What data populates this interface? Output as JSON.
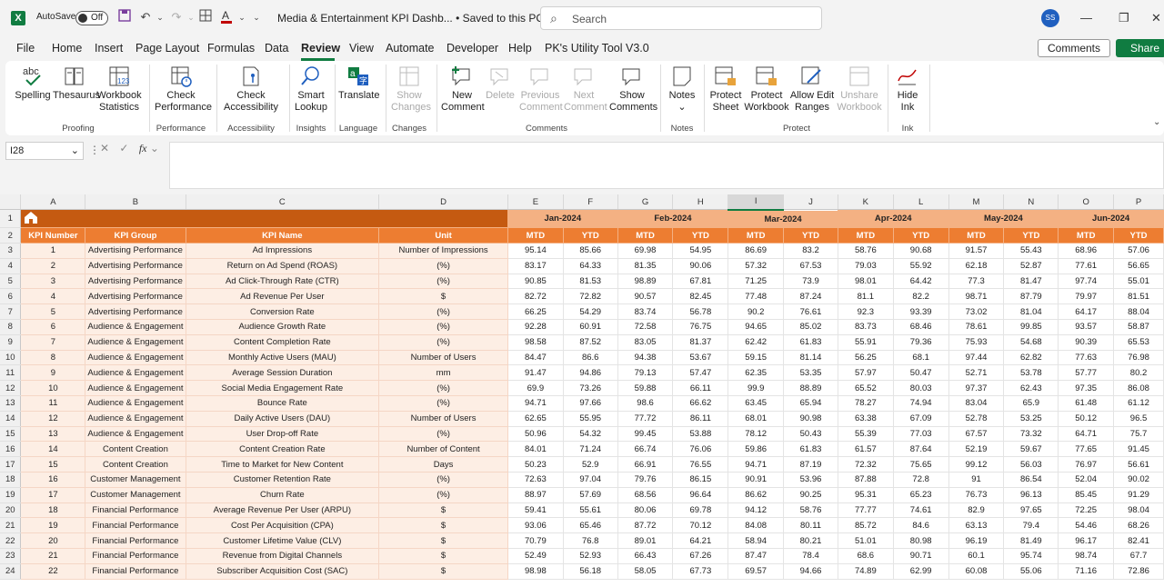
{
  "titlebar": {
    "app_logo": "X",
    "autosave_label": "AutoSave",
    "autosave_state": "Off",
    "doc_title": "Media & Entertainment KPI Dashb...  •  Saved to this PC",
    "search_placeholder": "Search",
    "user_initials": "SS"
  },
  "menu": [
    "File",
    "Home",
    "Insert",
    "Page Layout",
    "Formulas",
    "Data",
    "Review",
    "View",
    "Automate",
    "Developer",
    "Help",
    "PK's Utility Tool V3.0"
  ],
  "menu_active": "Review",
  "comments_button": "Comments",
  "share_button": "Share",
  "ribbon": {
    "spelling": "Spelling",
    "thesaurus": "Thesaurus",
    "workbook_stats": "Workbook Statistics",
    "proofing": "Proofing",
    "check_performance": "Check Performance",
    "performance": "Performance",
    "check_accessibility": "Check Accessibility",
    "accessibility": "Accessibility",
    "smart_lookup": "Smart Lookup",
    "insights": "Insights",
    "translate": "Translate",
    "language": "Language",
    "show_changes": "Show Changes",
    "changes": "Changes",
    "new_comment": "New Comment",
    "delete": "Delete",
    "previous_comment": "Previous Comment",
    "next_comment": "Next Comment",
    "show_comments": "Show Comments",
    "comments": "Comments",
    "notes_btn": "Notes",
    "notes": "Notes",
    "protect_sheet": "Protect Sheet",
    "protect_workbook": "Protect Workbook",
    "allow_edit_ranges": "Allow Edit Ranges",
    "unshare_workbook": "Unshare Workbook",
    "protect": "Protect",
    "hide_ink": "Hide Ink",
    "ink": "Ink"
  },
  "formula_bar": {
    "name_box": "I28",
    "fx": "fx"
  },
  "columns": [
    "A",
    "B",
    "C",
    "D",
    "E",
    "F",
    "G",
    "H",
    "I",
    "J",
    "K",
    "L",
    "M",
    "N",
    "O",
    "P"
  ],
  "months": [
    "Jan-2024",
    "Feb-2024",
    "Mar-2024",
    "Apr-2024",
    "May-2024",
    "Jun-2024"
  ],
  "headers": {
    "kpi_number": "KPI Number",
    "kpi_group": "KPI Group",
    "kpi_name": "KPI Name",
    "unit": "Unit",
    "mtd": "MTD",
    "ytd": "YTD"
  },
  "rows": [
    {
      "n": "1",
      "g": "Advertising Performance",
      "name": "Ad Impressions",
      "unit": "Number of Impressions",
      "v": [
        "95.14",
        "85.66",
        "69.98",
        "54.95",
        "86.69",
        "83.2",
        "58.76",
        "90.68",
        "91.57",
        "55.43",
        "68.96",
        "57.06"
      ]
    },
    {
      "n": "2",
      "g": "Advertising Performance",
      "name": "Return on Ad Spend (ROAS)",
      "unit": "(%)",
      "v": [
        "83.17",
        "64.33",
        "81.35",
        "90.06",
        "57.32",
        "67.53",
        "79.03",
        "55.92",
        "62.18",
        "52.87",
        "77.61",
        "56.65"
      ]
    },
    {
      "n": "3",
      "g": "Advertising Performance",
      "name": "Ad Click-Through Rate (CTR)",
      "unit": "(%)",
      "v": [
        "90.85",
        "81.53",
        "98.89",
        "67.81",
        "71.25",
        "73.9",
        "98.01",
        "64.42",
        "77.3",
        "81.47",
        "97.74",
        "55.01"
      ]
    },
    {
      "n": "4",
      "g": "Advertising Performance",
      "name": "Ad Revenue Per User",
      "unit": "$",
      "v": [
        "82.72",
        "72.82",
        "90.57",
        "82.45",
        "77.48",
        "87.24",
        "81.1",
        "82.2",
        "98.71",
        "87.79",
        "79.97",
        "81.51"
      ]
    },
    {
      "n": "5",
      "g": "Advertising Performance",
      "name": "Conversion Rate",
      "unit": "(%)",
      "v": [
        "66.25",
        "54.29",
        "83.74",
        "56.78",
        "90.2",
        "76.61",
        "92.3",
        "93.39",
        "73.02",
        "81.04",
        "64.17",
        "88.04"
      ]
    },
    {
      "n": "6",
      "g": "Audience & Engagement",
      "name": "Audience Growth Rate",
      "unit": "(%)",
      "v": [
        "92.28",
        "60.91",
        "72.58",
        "76.75",
        "94.65",
        "85.02",
        "83.73",
        "68.46",
        "78.61",
        "99.85",
        "93.57",
        "58.87"
      ]
    },
    {
      "n": "7",
      "g": "Audience & Engagement",
      "name": "Content Completion Rate",
      "unit": "(%)",
      "v": [
        "98.58",
        "87.52",
        "83.05",
        "81.37",
        "62.42",
        "61.83",
        "55.91",
        "79.36",
        "75.93",
        "54.68",
        "90.39",
        "65.53"
      ]
    },
    {
      "n": "8",
      "g": "Audience & Engagement",
      "name": "Monthly Active Users (MAU)",
      "unit": "Number of Users",
      "v": [
        "84.47",
        "86.6",
        "94.38",
        "53.67",
        "59.15",
        "81.14",
        "56.25",
        "68.1",
        "97.44",
        "62.82",
        "77.63",
        "76.98"
      ]
    },
    {
      "n": "9",
      "g": "Audience & Engagement",
      "name": "Average Session Duration",
      "unit": "mm",
      "v": [
        "91.47",
        "94.86",
        "79.13",
        "57.47",
        "62.35",
        "53.35",
        "57.97",
        "50.47",
        "52.71",
        "53.78",
        "57.77",
        "80.2"
      ]
    },
    {
      "n": "10",
      "g": "Audience & Engagement",
      "name": "Social Media Engagement Rate",
      "unit": "(%)",
      "v": [
        "69.9",
        "73.26",
        "59.88",
        "66.11",
        "99.9",
        "88.89",
        "65.52",
        "80.03",
        "97.37",
        "62.43",
        "97.35",
        "86.08"
      ]
    },
    {
      "n": "11",
      "g": "Audience & Engagement",
      "name": "Bounce Rate",
      "unit": "(%)",
      "v": [
        "94.71",
        "97.66",
        "98.6",
        "66.62",
        "63.45",
        "65.94",
        "78.27",
        "74.94",
        "83.04",
        "65.9",
        "61.48",
        "61.12"
      ]
    },
    {
      "n": "12",
      "g": "Audience & Engagement",
      "name": "Daily Active Users (DAU)",
      "unit": "Number of Users",
      "v": [
        "62.65",
        "55.95",
        "77.72",
        "86.11",
        "68.01",
        "90.98",
        "63.38",
        "67.09",
        "52.78",
        "53.25",
        "50.12",
        "96.5"
      ]
    },
    {
      "n": "13",
      "g": "Audience & Engagement",
      "name": "User Drop-off Rate",
      "unit": "(%)",
      "v": [
        "50.96",
        "54.32",
        "99.45",
        "53.88",
        "78.12",
        "50.43",
        "55.39",
        "77.03",
        "67.57",
        "73.32",
        "64.71",
        "75.7"
      ]
    },
    {
      "n": "14",
      "g": "Content Creation",
      "name": "Content Creation Rate",
      "unit": "Number of  Content",
      "v": [
        "84.01",
        "71.24",
        "66.74",
        "76.06",
        "59.86",
        "61.83",
        "61.57",
        "87.64",
        "52.19",
        "59.67",
        "77.65",
        "91.45"
      ]
    },
    {
      "n": "15",
      "g": "Content Creation",
      "name": "Time to Market for New Content",
      "unit": "Days",
      "v": [
        "50.23",
        "52.9",
        "66.91",
        "76.55",
        "94.71",
        "87.19",
        "72.32",
        "75.65",
        "99.12",
        "56.03",
        "76.97",
        "56.61"
      ]
    },
    {
      "n": "16",
      "g": "Customer Management",
      "name": "Customer Retention Rate",
      "unit": "(%)",
      "v": [
        "72.63",
        "97.04",
        "79.76",
        "86.15",
        "90.91",
        "53.96",
        "87.88",
        "72.8",
        "91",
        "86.54",
        "52.04",
        "90.02"
      ]
    },
    {
      "n": "17",
      "g": "Customer Management",
      "name": "Churn Rate",
      "unit": "(%)",
      "v": [
        "88.97",
        "57.69",
        "68.56",
        "96.64",
        "86.62",
        "90.25",
        "95.31",
        "65.23",
        "76.73",
        "96.13",
        "85.45",
        "91.29"
      ]
    },
    {
      "n": "18",
      "g": "Financial Performance",
      "name": "Average Revenue Per User (ARPU)",
      "unit": "$",
      "v": [
        "59.41",
        "55.61",
        "80.06",
        "69.78",
        "94.12",
        "58.76",
        "77.77",
        "74.61",
        "82.9",
        "97.65",
        "72.25",
        "98.04"
      ]
    },
    {
      "n": "19",
      "g": "Financial Performance",
      "name": "Cost Per Acquisition (CPA)",
      "unit": "$",
      "v": [
        "93.06",
        "65.46",
        "87.72",
        "70.12",
        "84.08",
        "80.11",
        "85.72",
        "84.6",
        "63.13",
        "79.4",
        "54.46",
        "68.26"
      ]
    },
    {
      "n": "20",
      "g": "Financial Performance",
      "name": "Customer Lifetime Value (CLV)",
      "unit": "$",
      "v": [
        "70.79",
        "76.8",
        "89.01",
        "64.21",
        "58.94",
        "80.21",
        "51.01",
        "80.98",
        "96.19",
        "81.49",
        "96.17",
        "82.41"
      ]
    },
    {
      "n": "21",
      "g": "Financial Performance",
      "name": "Revenue from Digital Channels",
      "unit": "$",
      "v": [
        "52.49",
        "52.93",
        "66.43",
        "67.26",
        "87.47",
        "78.4",
        "68.6",
        "90.71",
        "60.1",
        "95.74",
        "98.74",
        "67.7"
      ]
    },
    {
      "n": "22",
      "g": "Financial Performance",
      "name": "Subscriber Acquisition Cost (SAC)",
      "unit": "$",
      "v": [
        "98.98",
        "56.18",
        "58.05",
        "67.73",
        "69.57",
        "94.66",
        "74.89",
        "62.99",
        "60.08",
        "55.06",
        "71.16",
        "72.86"
      ]
    }
  ]
}
